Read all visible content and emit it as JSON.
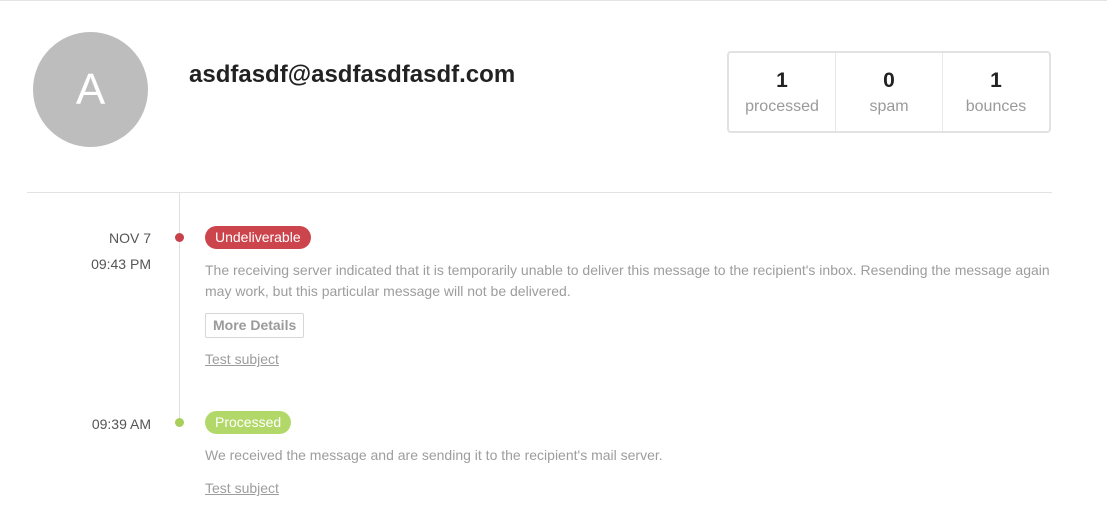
{
  "header": {
    "avatar_letter": "A",
    "email": "asdfasdf@asdfasdfasdf.com"
  },
  "stats": [
    {
      "value": "1",
      "label": "processed"
    },
    {
      "value": "0",
      "label": "spam"
    },
    {
      "value": "1",
      "label": "bounces"
    }
  ],
  "events": [
    {
      "date": "NOV 7",
      "time": "09:43 PM",
      "status": "Undeliverable",
      "status_color": "#cc444c",
      "description": "The receiving server indicated that it is temporarily unable to deliver this message to the recipient's inbox. Resending the message again may work, but this particular message will not be delivered.",
      "more_label": "More Details",
      "subject": "Test subject"
    },
    {
      "time": "09:39 AM",
      "status": "Processed",
      "status_color": "#b3d86a",
      "description": "We received the message and are sending it to the recipient's mail server.",
      "subject": "Test subject"
    }
  ]
}
